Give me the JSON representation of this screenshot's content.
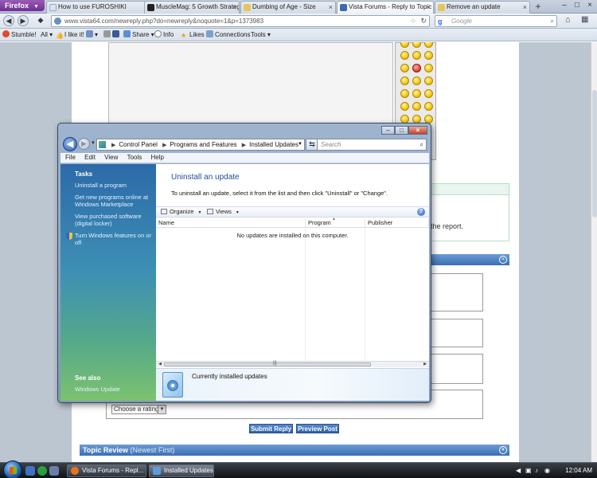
{
  "browser": {
    "firefox_label": "Firefox",
    "tabs": [
      {
        "label": "How to use FUROSHIKI",
        "color": "#d9e4f2"
      },
      {
        "label": "MuscleMag: 5 Growth Strateg...",
        "color": "#222222"
      },
      {
        "label": "Dumbing of Age - Size",
        "color": "#e6c65c"
      },
      {
        "label": "Vista Forums - Reply to Topic",
        "color": "#3a6ab5"
      },
      {
        "label": "Remove an update",
        "color": "#e6c65c"
      }
    ],
    "new_tab": "+",
    "url": "www.vista64.com/newreply.php?do=newreply&noquote=1&p=1373983",
    "search_placeholder": "Google",
    "toolbar": {
      "stumble": "Stumble!",
      "all": "All",
      "like": "I like it!",
      "share": "Share",
      "info": "Info",
      "likes": "Likes",
      "connections": "Connections",
      "tools": "Tools"
    }
  },
  "forum": {
    "report_text": "the report.",
    "rating_select": "Choose a rating",
    "submit_button": "Submit Reply",
    "preview_button": "Preview Post",
    "topic_review_title": "Topic Review",
    "topic_review_sub": "(Newest First)"
  },
  "window": {
    "breadcrumb": [
      "Control Panel",
      "Programs and Features",
      "Installed Updates"
    ],
    "search_placeholder": "Search",
    "menu": [
      "File",
      "Edit",
      "View",
      "Tools",
      "Help"
    ],
    "tasks": {
      "heading": "Tasks",
      "links": [
        "Uninstall a program",
        "Get new programs online at Windows Marketplace",
        "View purchased software (digital locker)",
        "Turn Windows features on or off"
      ],
      "see_also": "See also",
      "see_also_links": [
        "Windows Update"
      ]
    },
    "main": {
      "title": "Uninstall an update",
      "description": "To uninstall an update, select it from the list and then click \"Uninstall\" or \"Change\".",
      "commands": [
        "Organize",
        "Views"
      ],
      "columns": [
        "Name",
        "Program",
        "Publisher"
      ],
      "empty_message": "No updates are installed on this computer.",
      "details": "Currently installed updates"
    }
  },
  "taskbar": {
    "tasks": [
      {
        "label": "Vista Forums - Repl...",
        "color": "#e8741c"
      },
      {
        "label": "Installed Updates",
        "color": "#5f9bd8"
      }
    ],
    "clock": "12:04 AM"
  }
}
